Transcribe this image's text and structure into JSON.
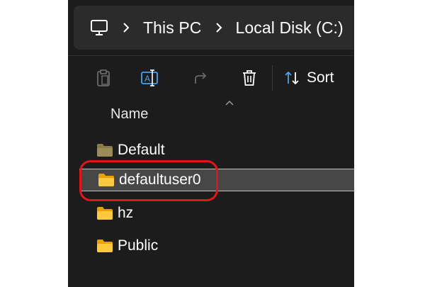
{
  "address": {
    "crumbs": [
      "This PC",
      "Local Disk (C:)"
    ]
  },
  "toolbar": {
    "sort_label": "Sort"
  },
  "list": {
    "column_name": "Name",
    "items": [
      {
        "label": "Default",
        "icon": "folder-icon-dim"
      },
      {
        "label": "defaultuser0",
        "icon": "folder-icon",
        "selected": true
      },
      {
        "label": "hz",
        "icon": "folder-icon"
      },
      {
        "label": "Public",
        "icon": "folder-icon"
      }
    ]
  },
  "colors": {
    "window_bg": "#1c1c1c",
    "address_bg": "#2b2b2b",
    "selection_bg": "#474747",
    "folder_yellow": "#ffc83d",
    "folder_dim": "#8a7a4a",
    "accent_blue": "#4aa3f0",
    "highlight_red": "#e0161c"
  }
}
